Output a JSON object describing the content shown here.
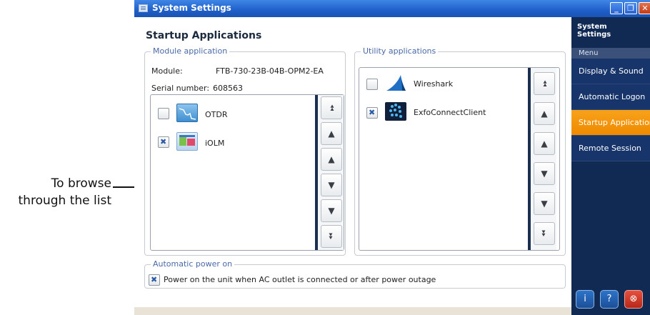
{
  "callout": {
    "line1": "To browse",
    "line2": "through the list"
  },
  "window": {
    "title": "System Settings",
    "min": "_",
    "max": "❐",
    "close": "✕"
  },
  "page": {
    "title": "Startup Applications"
  },
  "module_group": {
    "legend": "Module application",
    "module_label": "Module:",
    "module_value": "FTB-730-23B-04B-OPM2-EA",
    "serial_label": "Serial number:",
    "serial_value": "608563",
    "items": [
      {
        "label": "OTDR",
        "checked": false,
        "icon": "otdr-icon"
      },
      {
        "label": "iOLM",
        "checked": true,
        "icon": "iolm-icon"
      }
    ]
  },
  "utility_group": {
    "legend": "Utility applications",
    "items": [
      {
        "label": "Wireshark",
        "checked": false,
        "icon": "wireshark-icon"
      },
      {
        "label": "ExfoConnectClient",
        "checked": true,
        "icon": "exfoconnect-icon"
      }
    ]
  },
  "scroll_buttons": {
    "first": "⏫︎",
    "page_up": "▲",
    "up": "▲",
    "down": "▼",
    "page_down": "▼",
    "last": "⏬︎"
  },
  "power_group": {
    "legend": "Automatic power on",
    "label": "Power on the unit when AC outlet is connected or after power outage",
    "checked": true
  },
  "sidebar": {
    "header": "System Settings",
    "menu_label": "Menu",
    "items": [
      {
        "label": "Display & Sound",
        "active": false
      },
      {
        "label": "Automatic Logon",
        "active": false
      },
      {
        "label": "Startup Applications",
        "active": true
      },
      {
        "label": "Remote Session",
        "active": false
      }
    ],
    "buttons": {
      "info": "i",
      "help": "?",
      "exit": "⊗"
    }
  },
  "colors": {
    "titlebar": "#1f5fc9",
    "sidebar": "#102a54",
    "active_menu": "#f08a00",
    "legend": "#4a6aa8"
  }
}
